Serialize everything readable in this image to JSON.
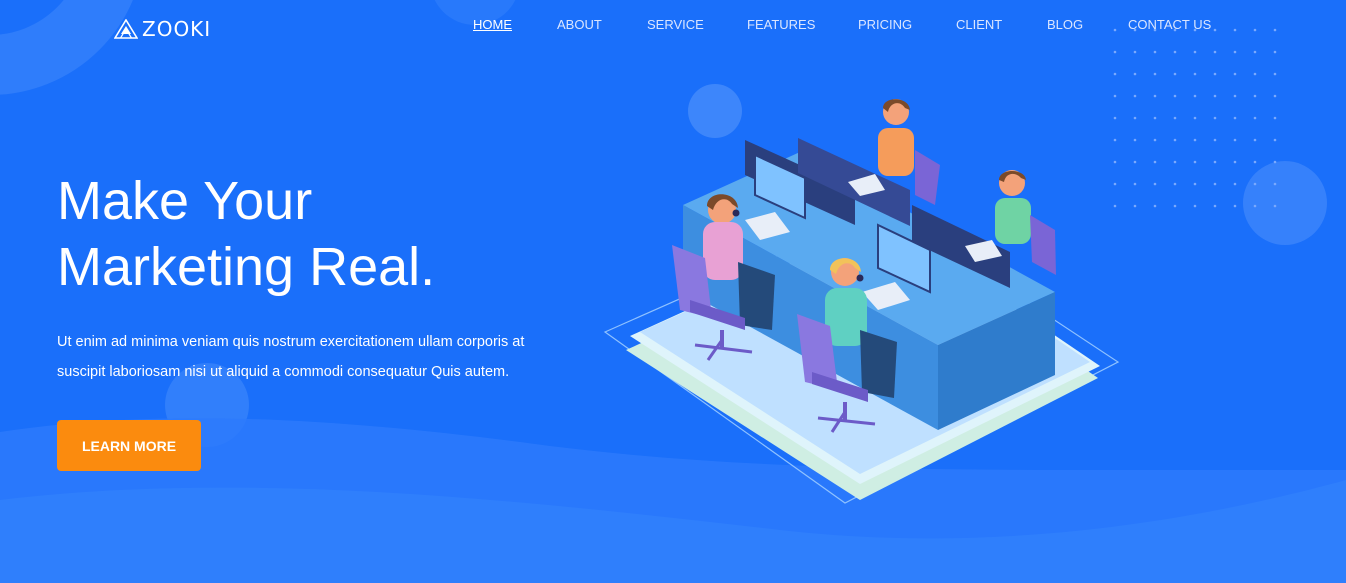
{
  "brand": {
    "name": "ZOOKI"
  },
  "nav": {
    "items": [
      {
        "label": "HOME",
        "active": true
      },
      {
        "label": "ABOUT",
        "active": false
      },
      {
        "label": "SERVICE",
        "active": false
      },
      {
        "label": "FEATURES",
        "active": false
      },
      {
        "label": "PRICING",
        "active": false
      },
      {
        "label": "CLIENT",
        "active": false
      },
      {
        "label": "BLOG",
        "active": false
      },
      {
        "label": "CONTACT US",
        "active": false
      }
    ]
  },
  "hero": {
    "title_line1": "Make Your",
    "title_line2": "Marketing Real.",
    "text_line1": "Ut enim ad minima veniam quis nostrum exercitationem ullam corporis at",
    "text_line2": "suscipit laboriosam nisi ut aliquid a commodi consequatur Quis autem.",
    "button_label": "LEARN MORE"
  },
  "colors": {
    "background": "#1a6ffa",
    "button": "#fb8b0e",
    "text": "#ffffff"
  },
  "illustration": {
    "icon": "office-team-isometric-illustration"
  }
}
